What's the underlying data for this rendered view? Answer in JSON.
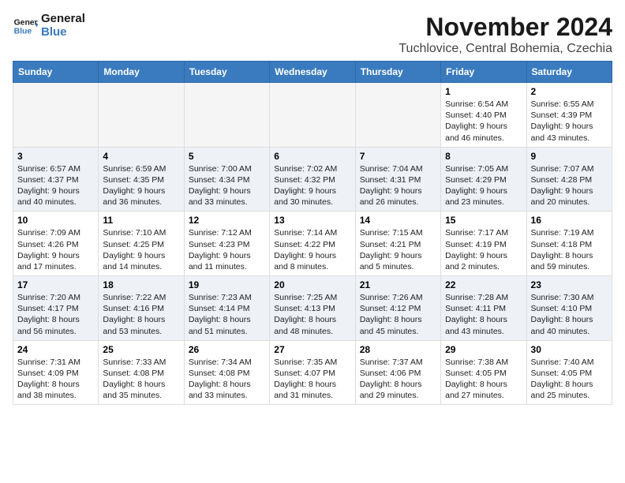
{
  "logo": {
    "line1": "General",
    "line2": "Blue"
  },
  "title": "November 2024",
  "location": "Tuchlovice, Central Bohemia, Czechia",
  "weekdays": [
    "Sunday",
    "Monday",
    "Tuesday",
    "Wednesday",
    "Thursday",
    "Friday",
    "Saturday"
  ],
  "weeks": [
    [
      {
        "day": "",
        "info": ""
      },
      {
        "day": "",
        "info": ""
      },
      {
        "day": "",
        "info": ""
      },
      {
        "day": "",
        "info": ""
      },
      {
        "day": "",
        "info": ""
      },
      {
        "day": "1",
        "info": "Sunrise: 6:54 AM\nSunset: 4:40 PM\nDaylight: 9 hours and 46 minutes."
      },
      {
        "day": "2",
        "info": "Sunrise: 6:55 AM\nSunset: 4:39 PM\nDaylight: 9 hours and 43 minutes."
      }
    ],
    [
      {
        "day": "3",
        "info": "Sunrise: 6:57 AM\nSunset: 4:37 PM\nDaylight: 9 hours and 40 minutes."
      },
      {
        "day": "4",
        "info": "Sunrise: 6:59 AM\nSunset: 4:35 PM\nDaylight: 9 hours and 36 minutes."
      },
      {
        "day": "5",
        "info": "Sunrise: 7:00 AM\nSunset: 4:34 PM\nDaylight: 9 hours and 33 minutes."
      },
      {
        "day": "6",
        "info": "Sunrise: 7:02 AM\nSunset: 4:32 PM\nDaylight: 9 hours and 30 minutes."
      },
      {
        "day": "7",
        "info": "Sunrise: 7:04 AM\nSunset: 4:31 PM\nDaylight: 9 hours and 26 minutes."
      },
      {
        "day": "8",
        "info": "Sunrise: 7:05 AM\nSunset: 4:29 PM\nDaylight: 9 hours and 23 minutes."
      },
      {
        "day": "9",
        "info": "Sunrise: 7:07 AM\nSunset: 4:28 PM\nDaylight: 9 hours and 20 minutes."
      }
    ],
    [
      {
        "day": "10",
        "info": "Sunrise: 7:09 AM\nSunset: 4:26 PM\nDaylight: 9 hours and 17 minutes."
      },
      {
        "day": "11",
        "info": "Sunrise: 7:10 AM\nSunset: 4:25 PM\nDaylight: 9 hours and 14 minutes."
      },
      {
        "day": "12",
        "info": "Sunrise: 7:12 AM\nSunset: 4:23 PM\nDaylight: 9 hours and 11 minutes."
      },
      {
        "day": "13",
        "info": "Sunrise: 7:14 AM\nSunset: 4:22 PM\nDaylight: 9 hours and 8 minutes."
      },
      {
        "day": "14",
        "info": "Sunrise: 7:15 AM\nSunset: 4:21 PM\nDaylight: 9 hours and 5 minutes."
      },
      {
        "day": "15",
        "info": "Sunrise: 7:17 AM\nSunset: 4:19 PM\nDaylight: 9 hours and 2 minutes."
      },
      {
        "day": "16",
        "info": "Sunrise: 7:19 AM\nSunset: 4:18 PM\nDaylight: 8 hours and 59 minutes."
      }
    ],
    [
      {
        "day": "17",
        "info": "Sunrise: 7:20 AM\nSunset: 4:17 PM\nDaylight: 8 hours and 56 minutes."
      },
      {
        "day": "18",
        "info": "Sunrise: 7:22 AM\nSunset: 4:16 PM\nDaylight: 8 hours and 53 minutes."
      },
      {
        "day": "19",
        "info": "Sunrise: 7:23 AM\nSunset: 4:14 PM\nDaylight: 8 hours and 51 minutes."
      },
      {
        "day": "20",
        "info": "Sunrise: 7:25 AM\nSunset: 4:13 PM\nDaylight: 8 hours and 48 minutes."
      },
      {
        "day": "21",
        "info": "Sunrise: 7:26 AM\nSunset: 4:12 PM\nDaylight: 8 hours and 45 minutes."
      },
      {
        "day": "22",
        "info": "Sunrise: 7:28 AM\nSunset: 4:11 PM\nDaylight: 8 hours and 43 minutes."
      },
      {
        "day": "23",
        "info": "Sunrise: 7:30 AM\nSunset: 4:10 PM\nDaylight: 8 hours and 40 minutes."
      }
    ],
    [
      {
        "day": "24",
        "info": "Sunrise: 7:31 AM\nSunset: 4:09 PM\nDaylight: 8 hours and 38 minutes."
      },
      {
        "day": "25",
        "info": "Sunrise: 7:33 AM\nSunset: 4:08 PM\nDaylight: 8 hours and 35 minutes."
      },
      {
        "day": "26",
        "info": "Sunrise: 7:34 AM\nSunset: 4:08 PM\nDaylight: 8 hours and 33 minutes."
      },
      {
        "day": "27",
        "info": "Sunrise: 7:35 AM\nSunset: 4:07 PM\nDaylight: 8 hours and 31 minutes."
      },
      {
        "day": "28",
        "info": "Sunrise: 7:37 AM\nSunset: 4:06 PM\nDaylight: 8 hours and 29 minutes."
      },
      {
        "day": "29",
        "info": "Sunrise: 7:38 AM\nSunset: 4:05 PM\nDaylight: 8 hours and 27 minutes."
      },
      {
        "day": "30",
        "info": "Sunrise: 7:40 AM\nSunset: 4:05 PM\nDaylight: 8 hours and 25 minutes."
      }
    ]
  ]
}
